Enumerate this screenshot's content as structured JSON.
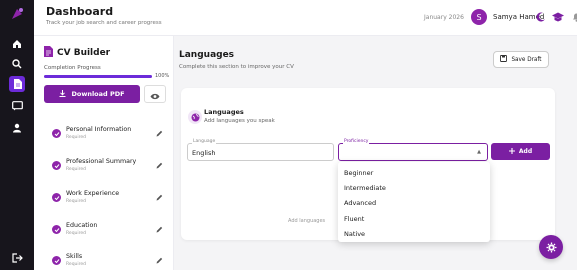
{
  "header": {
    "title": "Dashboard",
    "subtitle": "Track your job search and career progress",
    "date": "January 2026",
    "avatar_initial": "S",
    "user_name": "Samya Hamed"
  },
  "sidebar": {
    "title": "CV Builder",
    "completion_label": "Completion Progress",
    "completion_value": "100%",
    "completion_fraction": 1.0,
    "download_label": "Download PDF",
    "sections": [
      {
        "label": "Personal Information",
        "status": "Required"
      },
      {
        "label": "Professional Summary",
        "status": "Required"
      },
      {
        "label": "Work Experience",
        "status": "Required"
      },
      {
        "label": "Education",
        "status": "Required"
      },
      {
        "label": "Skills",
        "status": "Required"
      }
    ]
  },
  "main": {
    "title": "Languages",
    "subtitle": "Complete this section to improve your CV",
    "save_label": "Save Draft",
    "card": {
      "title": "Languages",
      "subtitle": "Add languages you speak",
      "language_field_label": "Language",
      "language_value": "English",
      "proficiency_field_label": "Proficiency",
      "proficiency_value": "",
      "add_label": "Add",
      "empty_text": "Add languages"
    },
    "proficiency_options": [
      "Beginner",
      "Intermediate",
      "Advanced",
      "Fluent",
      "Native"
    ]
  },
  "colors": {
    "accent": "#7b1fa2",
    "rail": "#17151c"
  }
}
